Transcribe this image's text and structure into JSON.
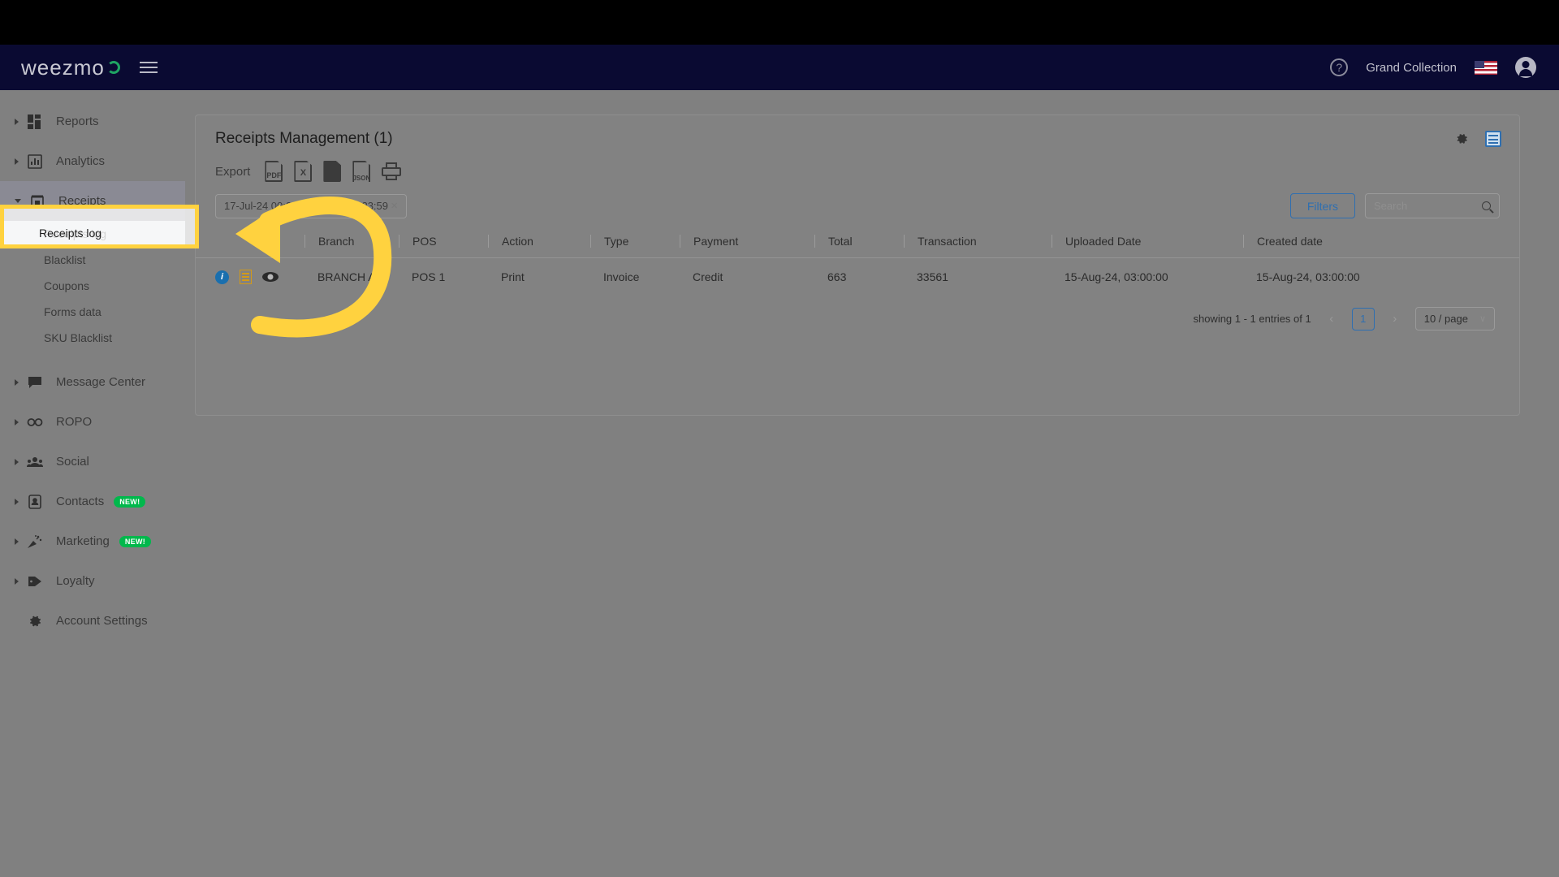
{
  "navbar": {
    "logo_text": "weezmo",
    "menu_icon": "hamburger-icon",
    "help_icon": "?",
    "org_name": "Grand Collection",
    "flag": "us-flag",
    "avatar": "account-icon"
  },
  "sidebar": {
    "items": [
      {
        "label": "Reports",
        "icon": "dashboard-icon",
        "expandable": true
      },
      {
        "label": "Analytics",
        "icon": "bar-chart-icon",
        "expandable": true
      },
      {
        "label": "Receipts",
        "icon": "receipt-icon",
        "expandable": true,
        "expanded": true
      },
      {
        "label": "Message Center",
        "icon": "chat-icon",
        "expandable": true
      },
      {
        "label": "ROPO",
        "icon": "infinity-icon",
        "expandable": true
      },
      {
        "label": "Social",
        "icon": "people-icon",
        "expandable": true
      },
      {
        "label": "Contacts",
        "icon": "contact-card-icon",
        "expandable": true,
        "badge": "NEW!"
      },
      {
        "label": "Marketing",
        "icon": "party-popper-icon",
        "expandable": true,
        "badge": "NEW!"
      },
      {
        "label": "Loyalty",
        "icon": "tag-icon",
        "expandable": true
      },
      {
        "label": "Account Settings",
        "icon": "gear-icon",
        "expandable": false
      }
    ],
    "receipts_sub_items": [
      {
        "label": "Receipts log",
        "selected": true
      },
      {
        "label": "Blacklist",
        "selected": false
      },
      {
        "label": "Coupons",
        "selected": false
      },
      {
        "label": "Forms data",
        "selected": false
      },
      {
        "label": "SKU Blacklist",
        "selected": false
      }
    ]
  },
  "card": {
    "title": "Receipts Management (1)",
    "settings_icon": "gear-icon",
    "columns_icon": "table-view-icon",
    "export_label": "Export",
    "export_options": [
      {
        "name": "pdf-export",
        "label": "PDF"
      },
      {
        "name": "excel-export",
        "label": "X"
      },
      {
        "name": "doc-export",
        "label": ""
      },
      {
        "name": "json-export",
        "label": "JSON"
      },
      {
        "name": "print-export",
        "label": ""
      }
    ],
    "date_range": "17-Jul-24 00:00 ~ 15-Aug-24 23:59",
    "date_clear": "×",
    "filters_label": "Filters",
    "search_placeholder": "Search",
    "search_value": ""
  },
  "table": {
    "columns": [
      "",
      "Branch",
      "POS",
      "Action",
      "Type",
      "Payment",
      "Total",
      "Transaction",
      "Uploaded Date",
      "Created date"
    ],
    "rows": [
      {
        "icons": [
          "info-icon",
          "receipt-icon",
          "eye-icon"
        ],
        "branch": "BRANCH A",
        "pos": "POS 1",
        "action": "Print",
        "type": "Invoice",
        "payment": "Credit",
        "total": "663",
        "transaction": "33561",
        "uploaded_date": "15-Aug-24, 03:00:00",
        "created_date": "15-Aug-24, 03:00:00"
      }
    ]
  },
  "pagination": {
    "summary": "showing 1 - 1 entries of 1",
    "prev": "‹",
    "current_page": "1",
    "next": "›",
    "page_size": "10 / page",
    "page_size_chevron": "∨"
  },
  "annotation": {
    "highlight_target": "Receipts log",
    "arrow_color": "#FFD23F",
    "highlight_color": "#FFD23F"
  }
}
